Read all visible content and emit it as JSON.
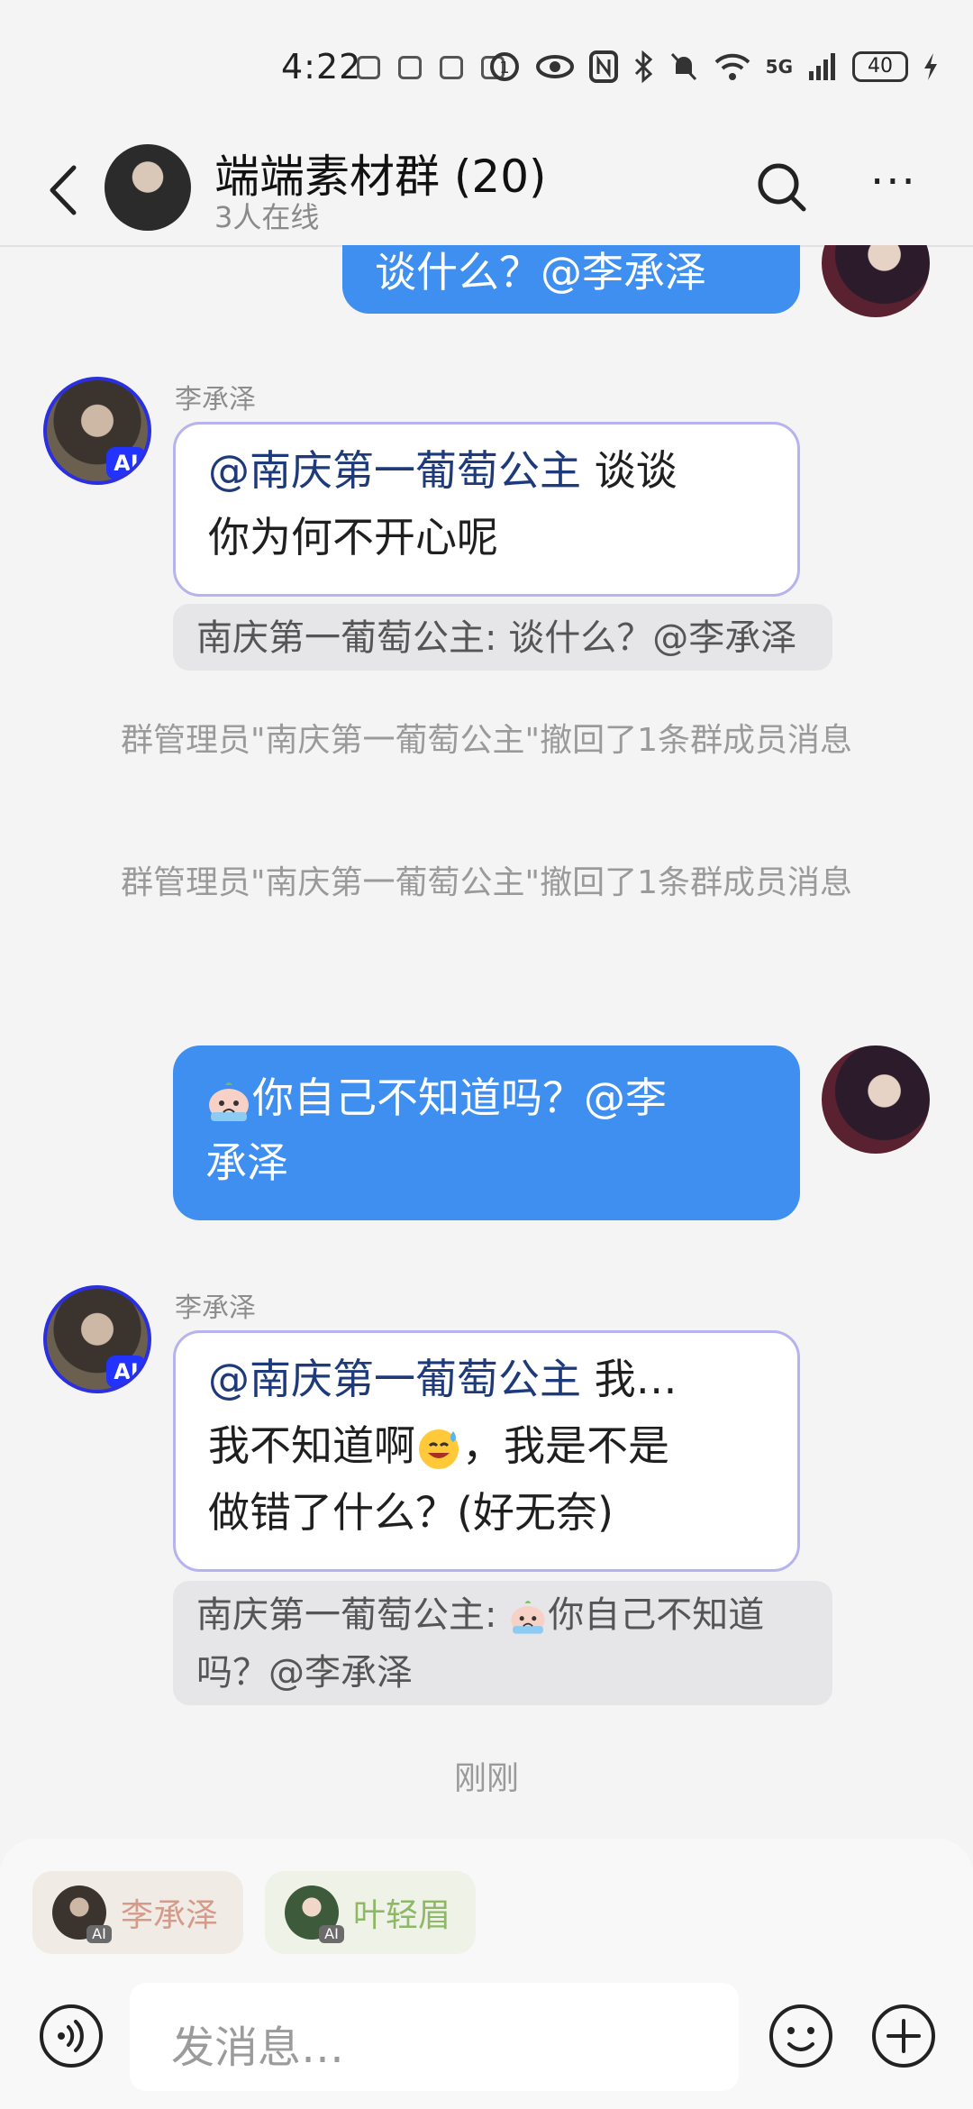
{
  "status": {
    "time": "4:22",
    "network": "5G",
    "battery": "40"
  },
  "header": {
    "title": "端端素材群 (20)",
    "subtitle": "3人在线",
    "more": "···"
  },
  "messages": {
    "top_partial": "谈什么？@李承泽",
    "reply1": {
      "sender": "李承泽",
      "ai_badge": "AI",
      "mention": "@南庆第一葡萄公主",
      "line1_rest": " 谈谈",
      "line2": "你为何不开心呢",
      "quote": "南庆第一葡萄公主: 谈什么？@李承泽"
    },
    "system1": "群管理员\"南庆第一葡萄公主\"撤回了1条群成员消息",
    "system2": "群管理员\"南庆第一葡萄公主\"撤回了1条群成员消息",
    "outgoing": {
      "line1": "你自己不知道吗？@李",
      "line2": "承泽"
    },
    "reply2": {
      "sender": "李承泽",
      "ai_badge": "AI",
      "mention": "@南庆第一葡萄公主",
      "line1_rest": " 我…",
      "line2_a": "我不知道啊",
      "line2_b": "，我是不是",
      "line3": "做错了什么？(好无奈)",
      "quote_prefix": "南庆第一葡萄公主: ",
      "quote_line1": "你自己不知道",
      "quote_line2": "吗？@李承泽"
    },
    "time_label": "刚刚"
  },
  "bottom": {
    "chips": [
      {
        "name": "李承泽",
        "badge": "AI"
      },
      {
        "name": "叶轻眉",
        "badge": "AI"
      }
    ],
    "input_placeholder": "发消息…"
  }
}
